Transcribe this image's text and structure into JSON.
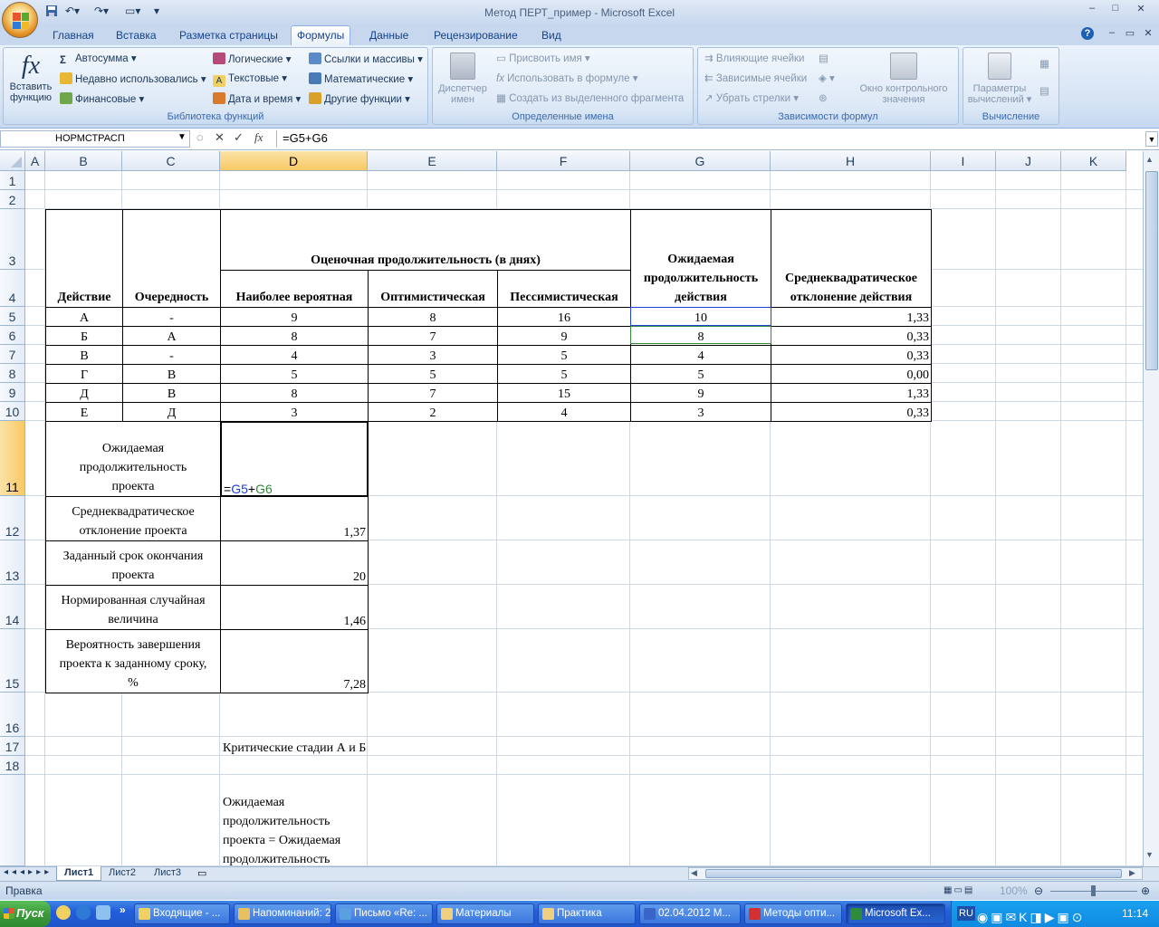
{
  "window": {
    "title": "Метод ПЕРТ_пример - Microsoft Excel",
    "controls": [
      "–",
      "□",
      "✕"
    ]
  },
  "tabs": [
    "Главная",
    "Вставка",
    "Разметка страницы",
    "Формулы",
    "Данные",
    "Рецензирование",
    "Вид"
  ],
  "active_tab": "Формулы",
  "ribbon": {
    "insert_function": [
      "Вставить",
      "функцию"
    ],
    "library": {
      "autosum": "Автосумма",
      "recent": "Недавно использовались",
      "financial": "Финансовые",
      "logical": "Логические",
      "text": "Текстовые",
      "datetime": "Дата и время",
      "lookup": "Ссылки и массивы",
      "math": "Математические",
      "other": "Другие функции",
      "label": "Библиотека функций"
    },
    "names": {
      "manager": [
        "Диспетчер",
        "имен"
      ],
      "define": "Присвоить имя",
      "use": "Использовать в формуле",
      "create": "Создать из выделенного фрагмента",
      "label": "Определенные имена"
    },
    "audit": {
      "precedents": "Влияющие ячейки",
      "dependents": "Зависимые ячейки",
      "remove": "Убрать стрелки",
      "watch": [
        "Окно контрольного",
        "значения"
      ],
      "label": "Зависимости формул"
    },
    "calc": {
      "options": [
        "Параметры",
        "вычислений"
      ],
      "label": "Вычисление"
    }
  },
  "formula_bar": {
    "name_box": "НОРМСТРАСП",
    "formula": "=G5+G6"
  },
  "columns": [
    "A",
    "B",
    "C",
    "D",
    "E",
    "F",
    "G",
    "H",
    "I",
    "J",
    "K"
  ],
  "rows": [
    "1",
    "2",
    "3",
    "4",
    "5",
    "6",
    "7",
    "8",
    "9",
    "10",
    "11",
    "12",
    "13",
    "14",
    "15",
    "16",
    "17",
    "18",
    ""
  ],
  "table": {
    "h_action": "Действие",
    "h_order": "Очередность",
    "h_estimated": "Оценочная продолжительность (в днях)",
    "h_likely": "Наиболее вероятная",
    "h_optimistic": "Оптимистическая",
    "h_pessimistic": "Пессимистическая",
    "h_expected": [
      "Ожидаемая",
      "продолжительность",
      "действия"
    ],
    "h_stddev": [
      "Среднеквадратическое",
      "отклонение действия"
    ],
    "rows": [
      {
        "action": "А",
        "order": "-",
        "likely": "9",
        "opt": "8",
        "pes": "16",
        "exp": "10",
        "sd": "1,33"
      },
      {
        "action": "Б",
        "order": "А",
        "likely": "8",
        "opt": "7",
        "pes": "9",
        "exp": "8",
        "sd": "0,33"
      },
      {
        "action": "В",
        "order": "-",
        "likely": "4",
        "opt": "3",
        "pes": "5",
        "exp": "4",
        "sd": "0,33"
      },
      {
        "action": "Г",
        "order": "В",
        "likely": "5",
        "opt": "5",
        "pes": "5",
        "exp": "5",
        "sd": "0,00"
      },
      {
        "action": "Д",
        "order": "В",
        "likely": "8",
        "opt": "7",
        "pes": "15",
        "exp": "9",
        "sd": "1,33"
      },
      {
        "action": "Е",
        "order": "Д",
        "likely": "3",
        "opt": "2",
        "pes": "4",
        "exp": "3",
        "sd": "0,33"
      }
    ]
  },
  "summary": [
    {
      "label": [
        "Ожидаемая",
        "продолжительность",
        "проекта"
      ],
      "value": "=G5+G6"
    },
    {
      "label": [
        "Среднеквадратическое",
        "отклонение проекта"
      ],
      "value": "1,37"
    },
    {
      "label": [
        "Заданный срок окончания",
        "проекта"
      ],
      "value": "20"
    },
    {
      "label": [
        "Нормированная случайная",
        "величина"
      ],
      "value": "1,46"
    },
    {
      "label": [
        "Вероятность завершения",
        "проекта к заданному сроку,",
        "%"
      ],
      "value": "7,28"
    }
  ],
  "note_row17": "Критические стадии А и Б",
  "note_row19": [
    "Ожидаемая",
    "продолжительность",
    "проекта = Ожидаемая",
    "продолжительность"
  ],
  "sheets": [
    "Лист1",
    "Лист2",
    "Лист3"
  ],
  "status": "Правка",
  "zoom": "100%",
  "taskbar": {
    "start": "Пуск",
    "tasks": [
      "Входящие - ...",
      "Напоминаний: 2",
      "Письмо «Re: ...",
      "Материалы",
      "Практика",
      "02.04.2012 М...",
      "Методы опти...",
      "Microsoft Ex..."
    ],
    "tray_lang": "RU",
    "clock": "11:14"
  }
}
